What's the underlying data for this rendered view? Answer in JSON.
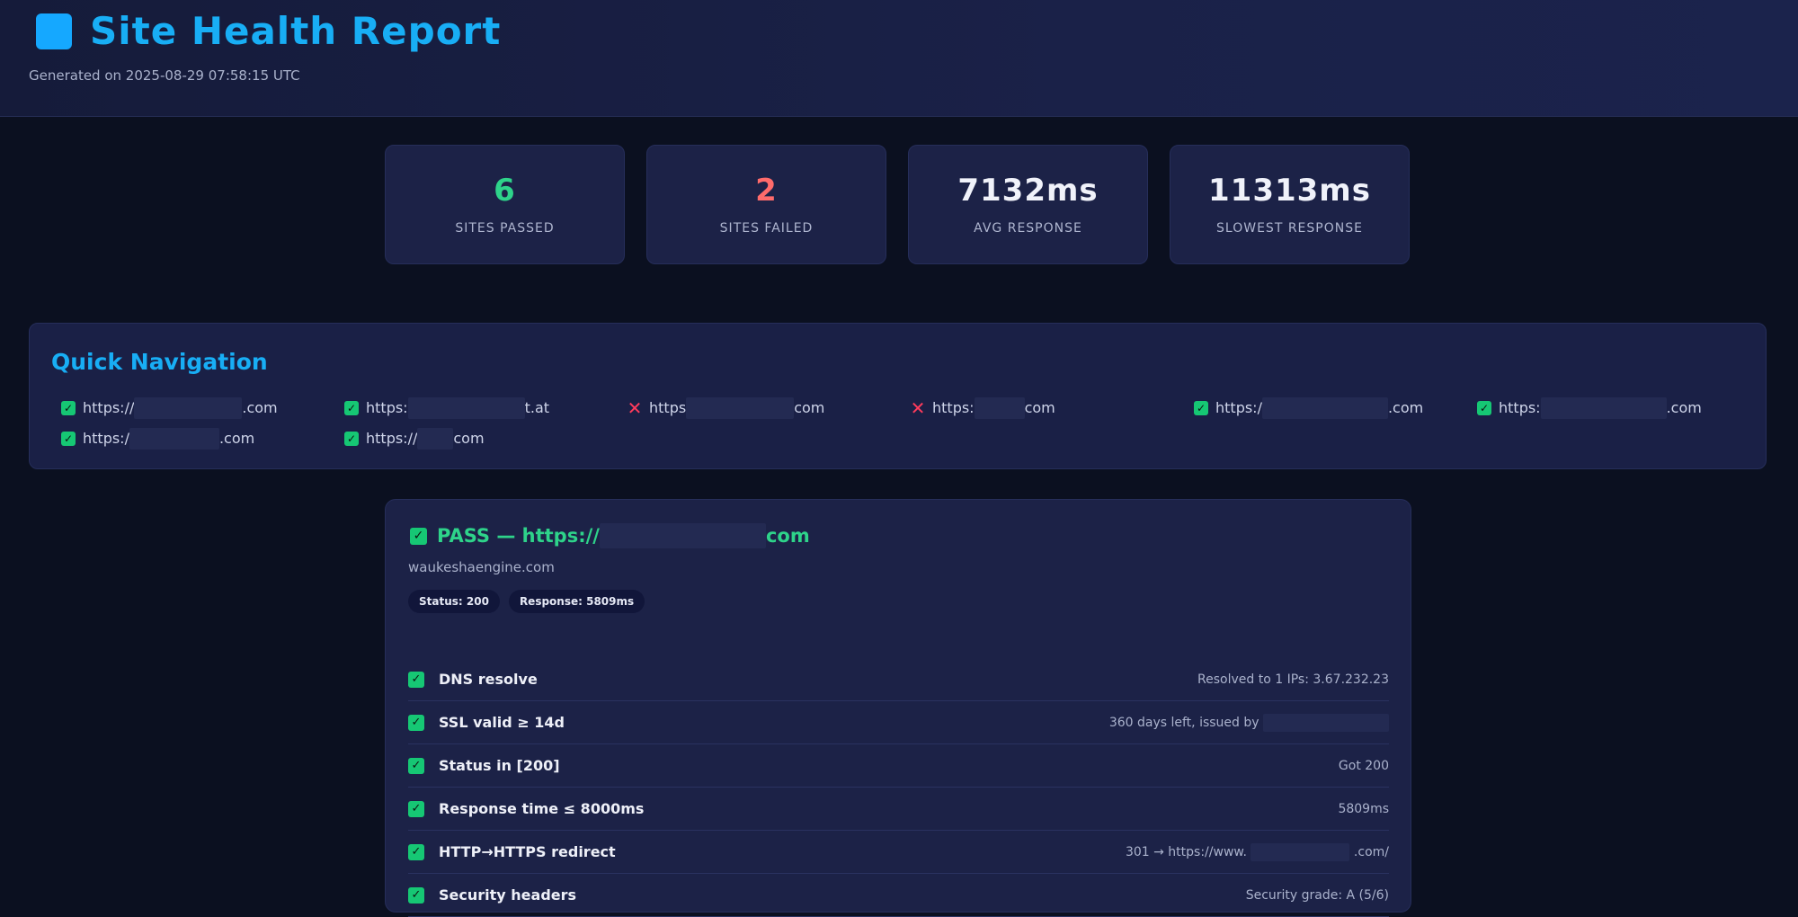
{
  "header": {
    "title": "Site Health Report",
    "generated": "Generated on 2025-08-29 07:58:15 UTC"
  },
  "stats": [
    {
      "value": "6",
      "label": "SITES PASSED",
      "status": "pass"
    },
    {
      "value": "2",
      "label": "SITES FAILED",
      "status": "fail"
    },
    {
      "value": "7132ms",
      "label": "AVG RESPONSE",
      "status": "neutral"
    },
    {
      "value": "11313ms",
      "label": "SLOWEST RESPONSE",
      "status": "neutral"
    }
  ],
  "quick_nav": {
    "title": "Quick Navigation",
    "items": [
      {
        "status": "pass",
        "prefix": "https://",
        "suffix": ".com"
      },
      {
        "status": "pass",
        "prefix": "https:",
        "suffix": "t.at"
      },
      {
        "status": "fail",
        "prefix": "https",
        "suffix": "com"
      },
      {
        "status": "fail",
        "prefix": "https:",
        "suffix": "com"
      },
      {
        "status": "pass",
        "prefix": "https:/",
        "suffix": ".com"
      },
      {
        "status": "pass",
        "prefix": "https:",
        "suffix": ".com"
      },
      {
        "status": "pass",
        "prefix": "https:/",
        "suffix": ".com"
      },
      {
        "status": "pass",
        "prefix": "https://",
        "suffix": "com"
      }
    ]
  },
  "detail": {
    "heading_prefix": "PASS — https://",
    "heading_suffix": "com",
    "host": "waukeshaengine.com",
    "status_pill": "Status: 200",
    "response_pill": "Response: 5809ms",
    "checks": [
      {
        "name": "DNS resolve",
        "detail": "Resolved to 1 IPs: 3.67.232.23"
      },
      {
        "name": "SSL valid ≥ 14d",
        "detail": "360 days left, issued by"
      },
      {
        "name": "Status in [200]",
        "detail": "Got 200"
      },
      {
        "name": "Response time ≤ 8000ms",
        "detail": "5809ms"
      },
      {
        "name": "HTTP→HTTPS redirect",
        "detail": "301 → https://www.",
        "detail_suffix": ".com/"
      },
      {
        "name": "Security headers",
        "detail": "Security grade: A (5/6)"
      }
    ]
  },
  "colors": {
    "accent": "#18aef5",
    "pass": "#2ed38a",
    "fail": "#ff6b6b",
    "background": "#0b1020",
    "card": "#1c2247"
  },
  "icons": {
    "pass": "check-icon",
    "fail": "cross-icon",
    "logo": "logo-square-icon"
  }
}
